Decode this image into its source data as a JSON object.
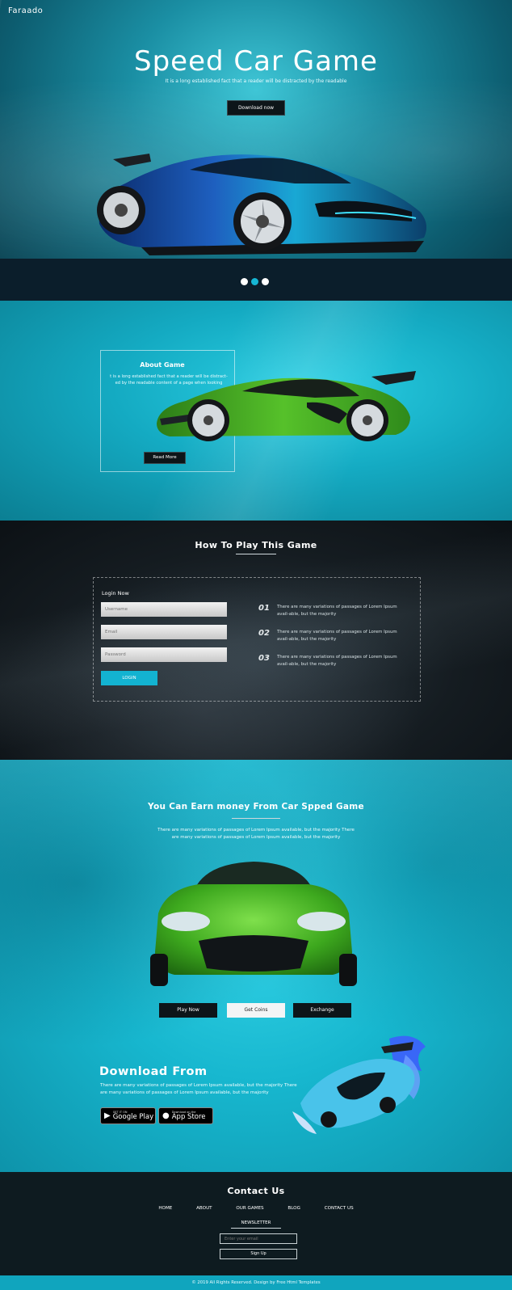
{
  "hero": {
    "logo": "Faraado",
    "title": "Speed Car Game",
    "subtitle": "It is a long established fact that a reader will be distracted by the readable",
    "download_label": "Download now",
    "slides": 3,
    "active_slide": 2
  },
  "about": {
    "title": "About Game",
    "text": "t is a long established fact that a reader will be distract-ed by the readable content of a page when looking",
    "read_more_label": "Read More"
  },
  "howto": {
    "title": "How To Play This Game",
    "login_title": "Login Now",
    "username_placeholder": "Username",
    "email_placeholder": "Email",
    "password_placeholder": "Password",
    "login_label": "LOGIN",
    "steps": [
      {
        "num": "01",
        "text": "There are many variations of passages of Lorem Ipsum avail-able, but the majority"
      },
      {
        "num": "02",
        "text": "There are many variations of passages of Lorem Ipsum avail-able, but the majority"
      },
      {
        "num": "03",
        "text": "There are many variations of passages of Lorem Ipsum avail-able, but the majority"
      }
    ]
  },
  "earn": {
    "title": "You Can Earn money From Car Spped Game",
    "text": "There are many variations of passages of Lorem Ipsum available, but the majority There are many variations of passages of Lorem Ipsum available, but the majority",
    "buttons": [
      "Play Now",
      "Get Coins",
      "Exchange"
    ]
  },
  "download": {
    "title": "Download From",
    "text": "There are many variations of passages of Lorem Ipsum available, but the majority There are many variations of passages of Lorem Ipsum available, but the majority",
    "google_small": "GET IT ON",
    "google_big": "Google Play",
    "apple_small": "Download on the",
    "apple_big": "App Store"
  },
  "contact": {
    "title": "Contact Us",
    "nav": [
      "HOME",
      "ABOUT",
      "OUR GAMES",
      "BLOG",
      "CONTACT US"
    ],
    "newsletter_label": "NEWSLETTER",
    "email_placeholder": "Enter your email",
    "signup_label": "Sign Up",
    "copyright": "© 2019 All Rights Reserved. Design by Free Html Templates"
  },
  "colors": {
    "accent": "#13b3d1",
    "dark": "#0d1519",
    "footer": "#0e1b20"
  }
}
